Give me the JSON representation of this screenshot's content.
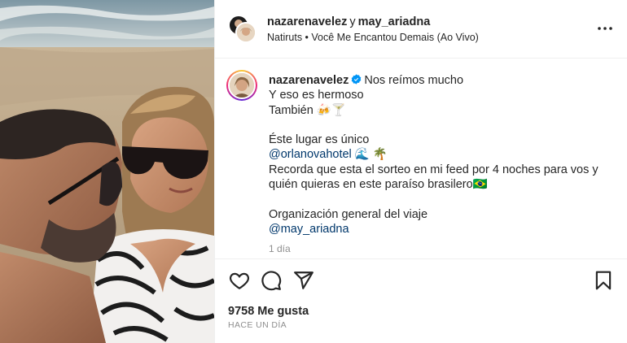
{
  "header": {
    "user1": "nazarenavelez",
    "joiner": "y",
    "user2": "may_ariadna",
    "music": "Natiruts • Você Me Encantou Demais (Ao Vivo)"
  },
  "caption": {
    "username": "nazarenavelez",
    "line1": "Nos reímos mucho",
    "line2": "Y eso es hermoso",
    "line3": "También 🍻🍸",
    "line4": "Éste lugar es único",
    "mention_hotel": "@orlanovahotel",
    "hotel_emoji": " 🌊 🌴",
    "line6": "Recorda que esta el sorteo en mi feed por 4 noches para vos y quién quieras en este paraíso brasilero🇧🇷",
    "line7": "Organización general del viaje",
    "mention_org": "@may_ariadna",
    "time_ago": "1 día"
  },
  "footer": {
    "likes": "9758 Me gusta",
    "date": "HACE UN DÍA"
  },
  "icons": {
    "like": "heart-icon",
    "comment": "comment-icon",
    "share": "send-icon",
    "save": "bookmark-icon",
    "more": "more-icon",
    "verified": "verified-badge-icon"
  },
  "colors": {
    "verified": "#0095f6",
    "mention": "#00376b",
    "muted": "#8e8e8e"
  }
}
